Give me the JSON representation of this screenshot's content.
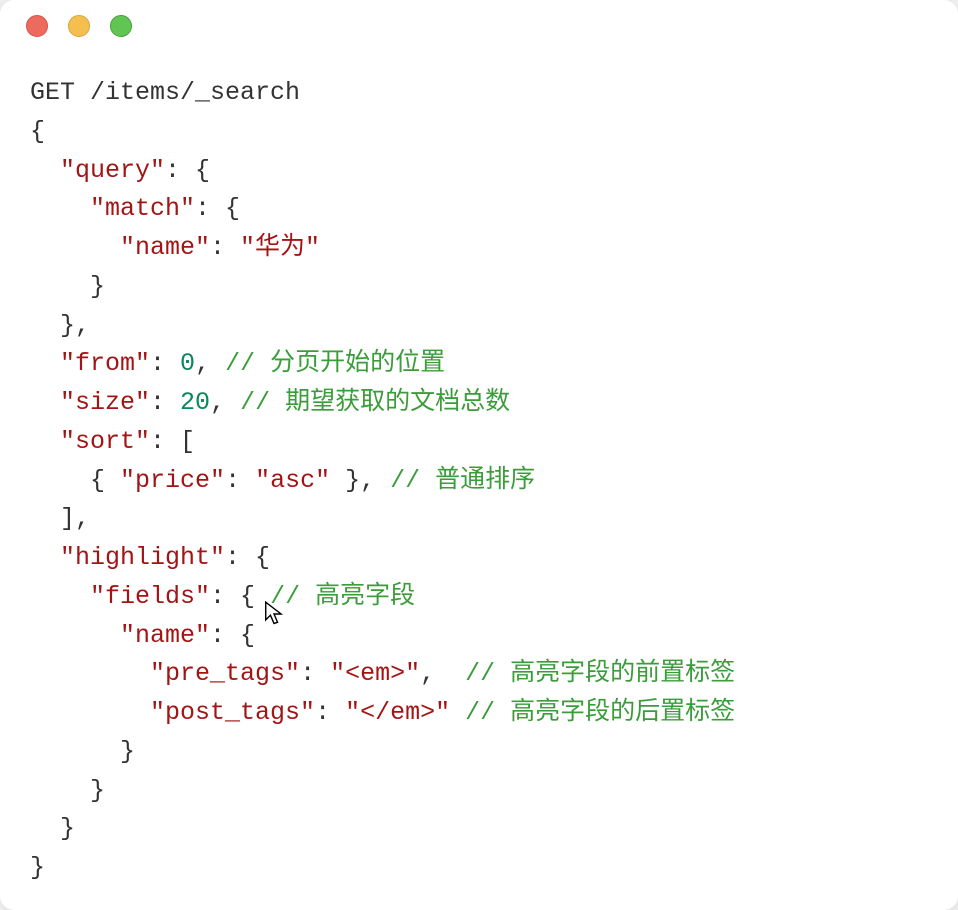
{
  "request_line": "GET /items/_search",
  "keys": {
    "query": "\"query\"",
    "match": "\"match\"",
    "name": "\"name\"",
    "from": "\"from\"",
    "size": "\"size\"",
    "sort": "\"sort\"",
    "price": "\"price\"",
    "highlight": "\"highlight\"",
    "fields": "\"fields\"",
    "pre_tags": "\"pre_tags\"",
    "post_tags": "\"post_tags\""
  },
  "values": {
    "name_value": "\"华为\"",
    "from_value": "0",
    "size_value": "20",
    "asc": "\"asc\"",
    "em_open": "\"<em>\"",
    "em_close": "\"</em>\""
  },
  "comments": {
    "from": "// 分页开始的位置",
    "size": "// 期望获取的文档总数",
    "sort": "// 普通排序",
    "fields": "// 高亮字段",
    "pre_tags": "// 高亮字段的前置标签",
    "post_tags": "// 高亮字段的后置标签"
  }
}
